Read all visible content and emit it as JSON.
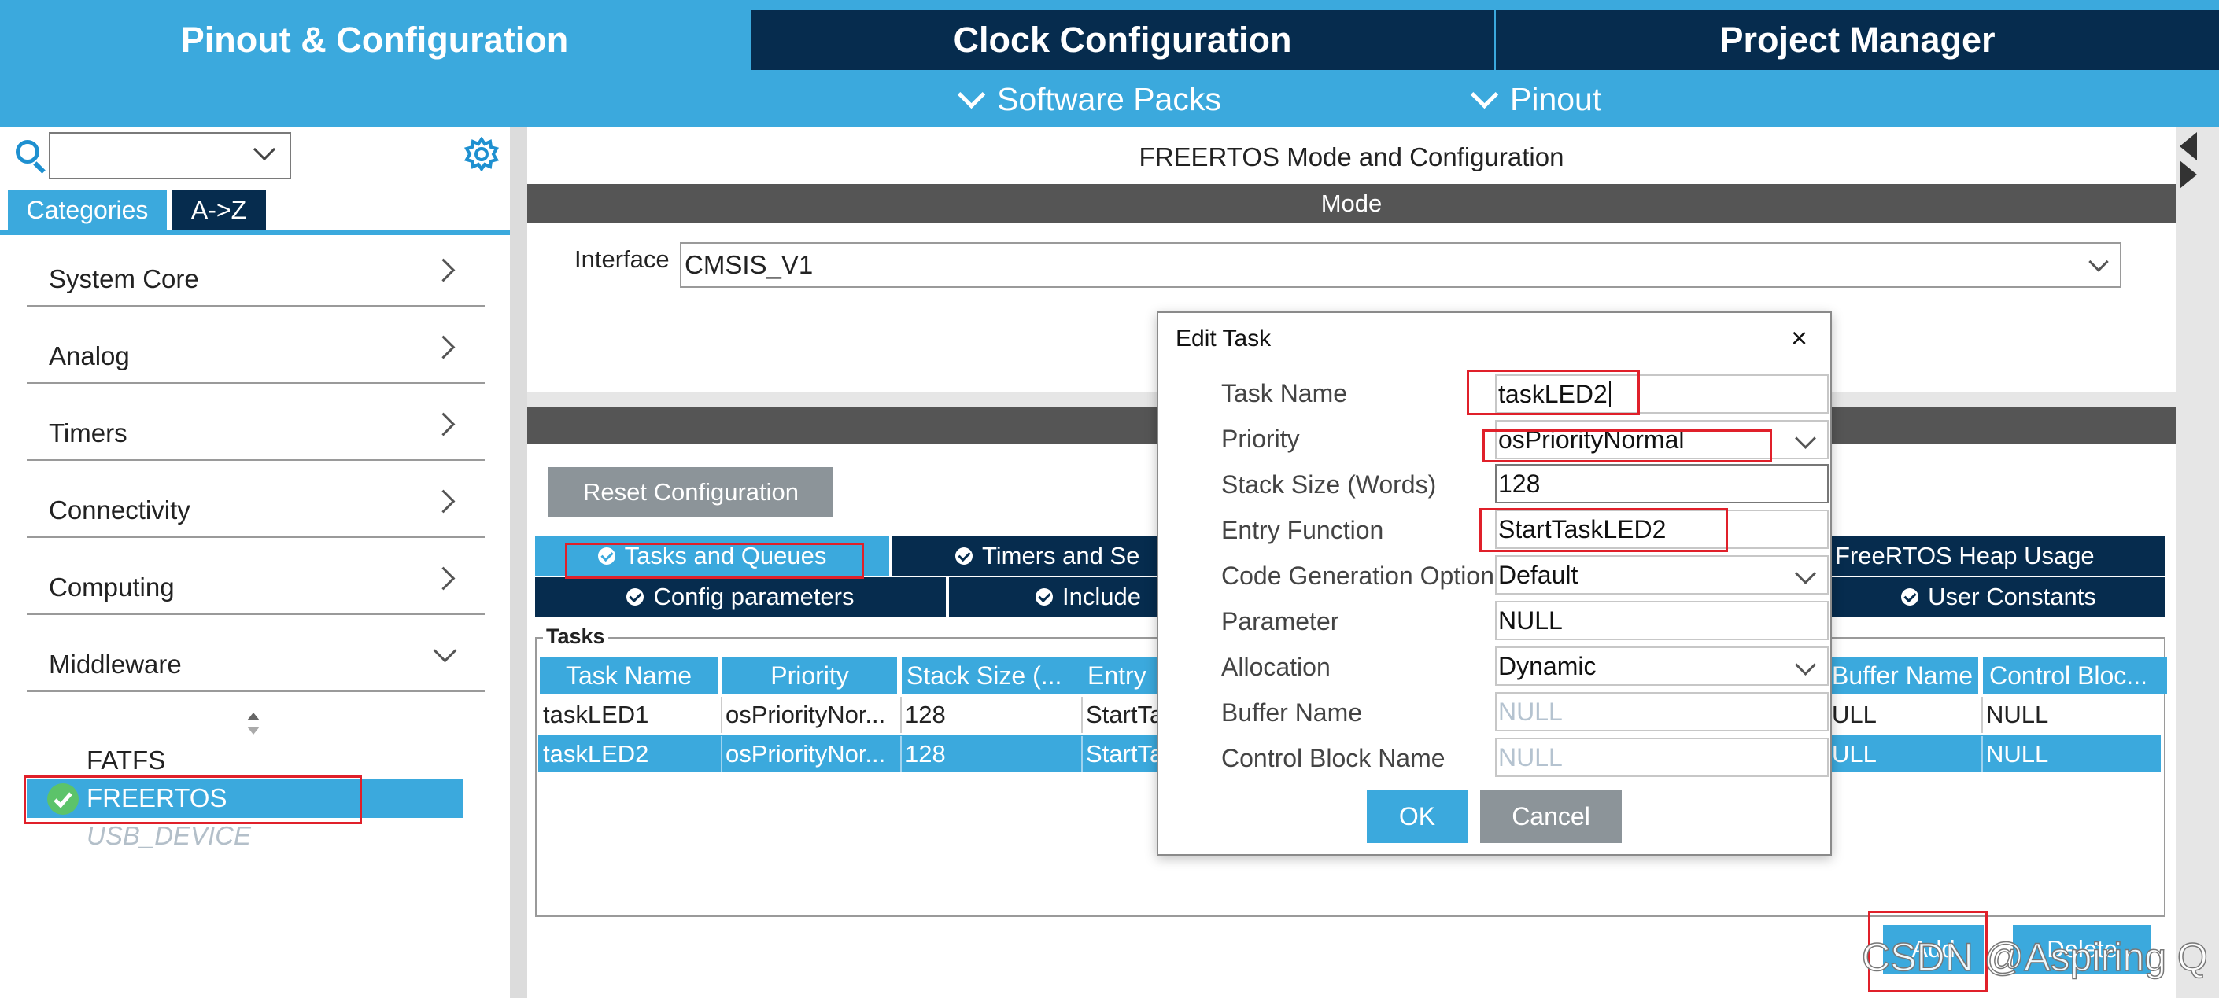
{
  "top_tabs": {
    "pinout": "Pinout & Configuration",
    "clock": "Clock Configuration",
    "project": "Project Manager"
  },
  "subnav": {
    "software_packs": "Software Packs",
    "pinout": "Pinout"
  },
  "left": {
    "tabs": {
      "categories": "Categories",
      "az": "A->Z"
    },
    "categories": [
      "System Core",
      "Analog",
      "Timers",
      "Connectivity",
      "Computing",
      "Middleware"
    ],
    "middleware_items": [
      "FATFS",
      "FREERTOS",
      "USB_DEVICE"
    ]
  },
  "main": {
    "title": "FREERTOS Mode and Configuration",
    "mode_bar": "Mode",
    "interface_label": "Interface",
    "interface_value": "CMSIS_V1",
    "reset_button": "Reset Configuration",
    "subtabs_row1": [
      "Tasks and Queues",
      "Timers and Se",
      "FreeRTOS Heap Usage"
    ],
    "subtabs_row2": [
      "Config parameters",
      "Include",
      "User Constants"
    ],
    "tasks_legend": "Tasks",
    "table": {
      "headers": [
        "Task Name",
        "Priority",
        "Stack Size (...",
        "Entry",
        "Buffer Name",
        "Control Bloc..."
      ],
      "rows": [
        [
          "taskLED1",
          "osPriorityNor...",
          "128",
          "StartTa",
          "ULL",
          "NULL"
        ],
        [
          "taskLED2",
          "osPriorityNor...",
          "128",
          "StartTa",
          "ULL",
          "NULL"
        ]
      ]
    },
    "add_button": "Add",
    "delete_button": "Delete"
  },
  "dialog": {
    "title": "Edit Task",
    "close": "×",
    "fields": {
      "task_name": {
        "label": "Task Name",
        "value": "taskLED2"
      },
      "priority": {
        "label": "Priority",
        "value": "osPriorityNormal"
      },
      "stack_size": {
        "label": "Stack Size (Words)",
        "value": "128"
      },
      "entry_function": {
        "label": "Entry Function",
        "value": "StartTaskLED2"
      },
      "codegen": {
        "label": "Code Generation Option",
        "value": "Default"
      },
      "parameter": {
        "label": "Parameter",
        "value": "NULL"
      },
      "allocation": {
        "label": "Allocation",
        "value": "Dynamic"
      },
      "buffer_name": {
        "label": "Buffer Name",
        "value": "NULL"
      },
      "control_block": {
        "label": "Control Block Name",
        "value": "NULL"
      }
    },
    "ok": "OK",
    "cancel": "Cancel"
  },
  "watermark": "CSDN @Aspiring Q",
  "colors": {
    "accent": "#3ba9dd",
    "navy": "#062c4e",
    "annotation": "#e0202a"
  }
}
